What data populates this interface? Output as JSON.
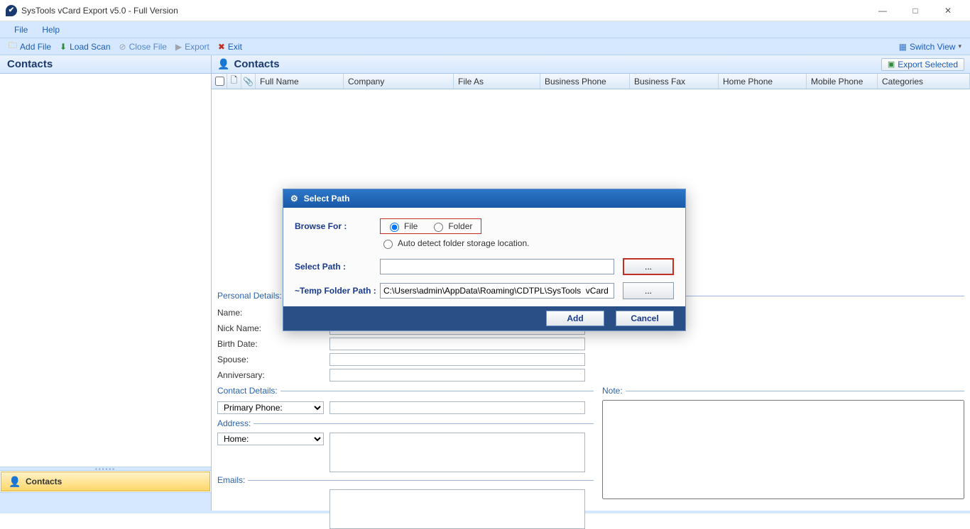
{
  "window": {
    "title": "SysTools  vCard Export v5.0  - Full Version"
  },
  "menubar": {
    "file": "File",
    "help": "Help"
  },
  "toolbar": {
    "add_file": "Add File",
    "load_scan": "Load Scan",
    "close_file": "Close File",
    "export": "Export",
    "exit": "Exit",
    "switch_view": "Switch View"
  },
  "sidebar": {
    "heading": "Contacts",
    "nav_label": "Contacts"
  },
  "main": {
    "heading": "Contacts",
    "export_selected": "Export Selected",
    "columns": {
      "full_name": "Full Name",
      "company": "Company",
      "file_as": "File As",
      "business_phone": "Business Phone",
      "business_fax": "Business Fax",
      "home_phone": "Home Phone",
      "mobile_phone": "Mobile Phone",
      "categories": "Categories"
    }
  },
  "details": {
    "personal_legend": "Personal Details:",
    "name": "Name:",
    "nick": "Nick Name:",
    "birth": "Birth Date:",
    "spouse": "Spouse:",
    "anniv": "Anniversary:",
    "contact_legend": "Contact Details:",
    "primary_phone": "Primary Phone:",
    "address_legend": "Address:",
    "address_sel": "Home:",
    "emails_legend": "Emails:",
    "note_legend": "Note:"
  },
  "dialog": {
    "title": "Select Path",
    "browse_for": "Browse For :",
    "opt_file": "File",
    "opt_folder": "Folder",
    "auto_detect": "Auto detect folder storage location.",
    "select_path": "Select Path :",
    "temp_label": "~Temp Folder Path :",
    "temp_value": "C:\\Users\\admin\\AppData\\Roaming\\CDTPL\\SysTools  vCard Export",
    "browse": "...",
    "add": "Add",
    "cancel": "Cancel"
  }
}
